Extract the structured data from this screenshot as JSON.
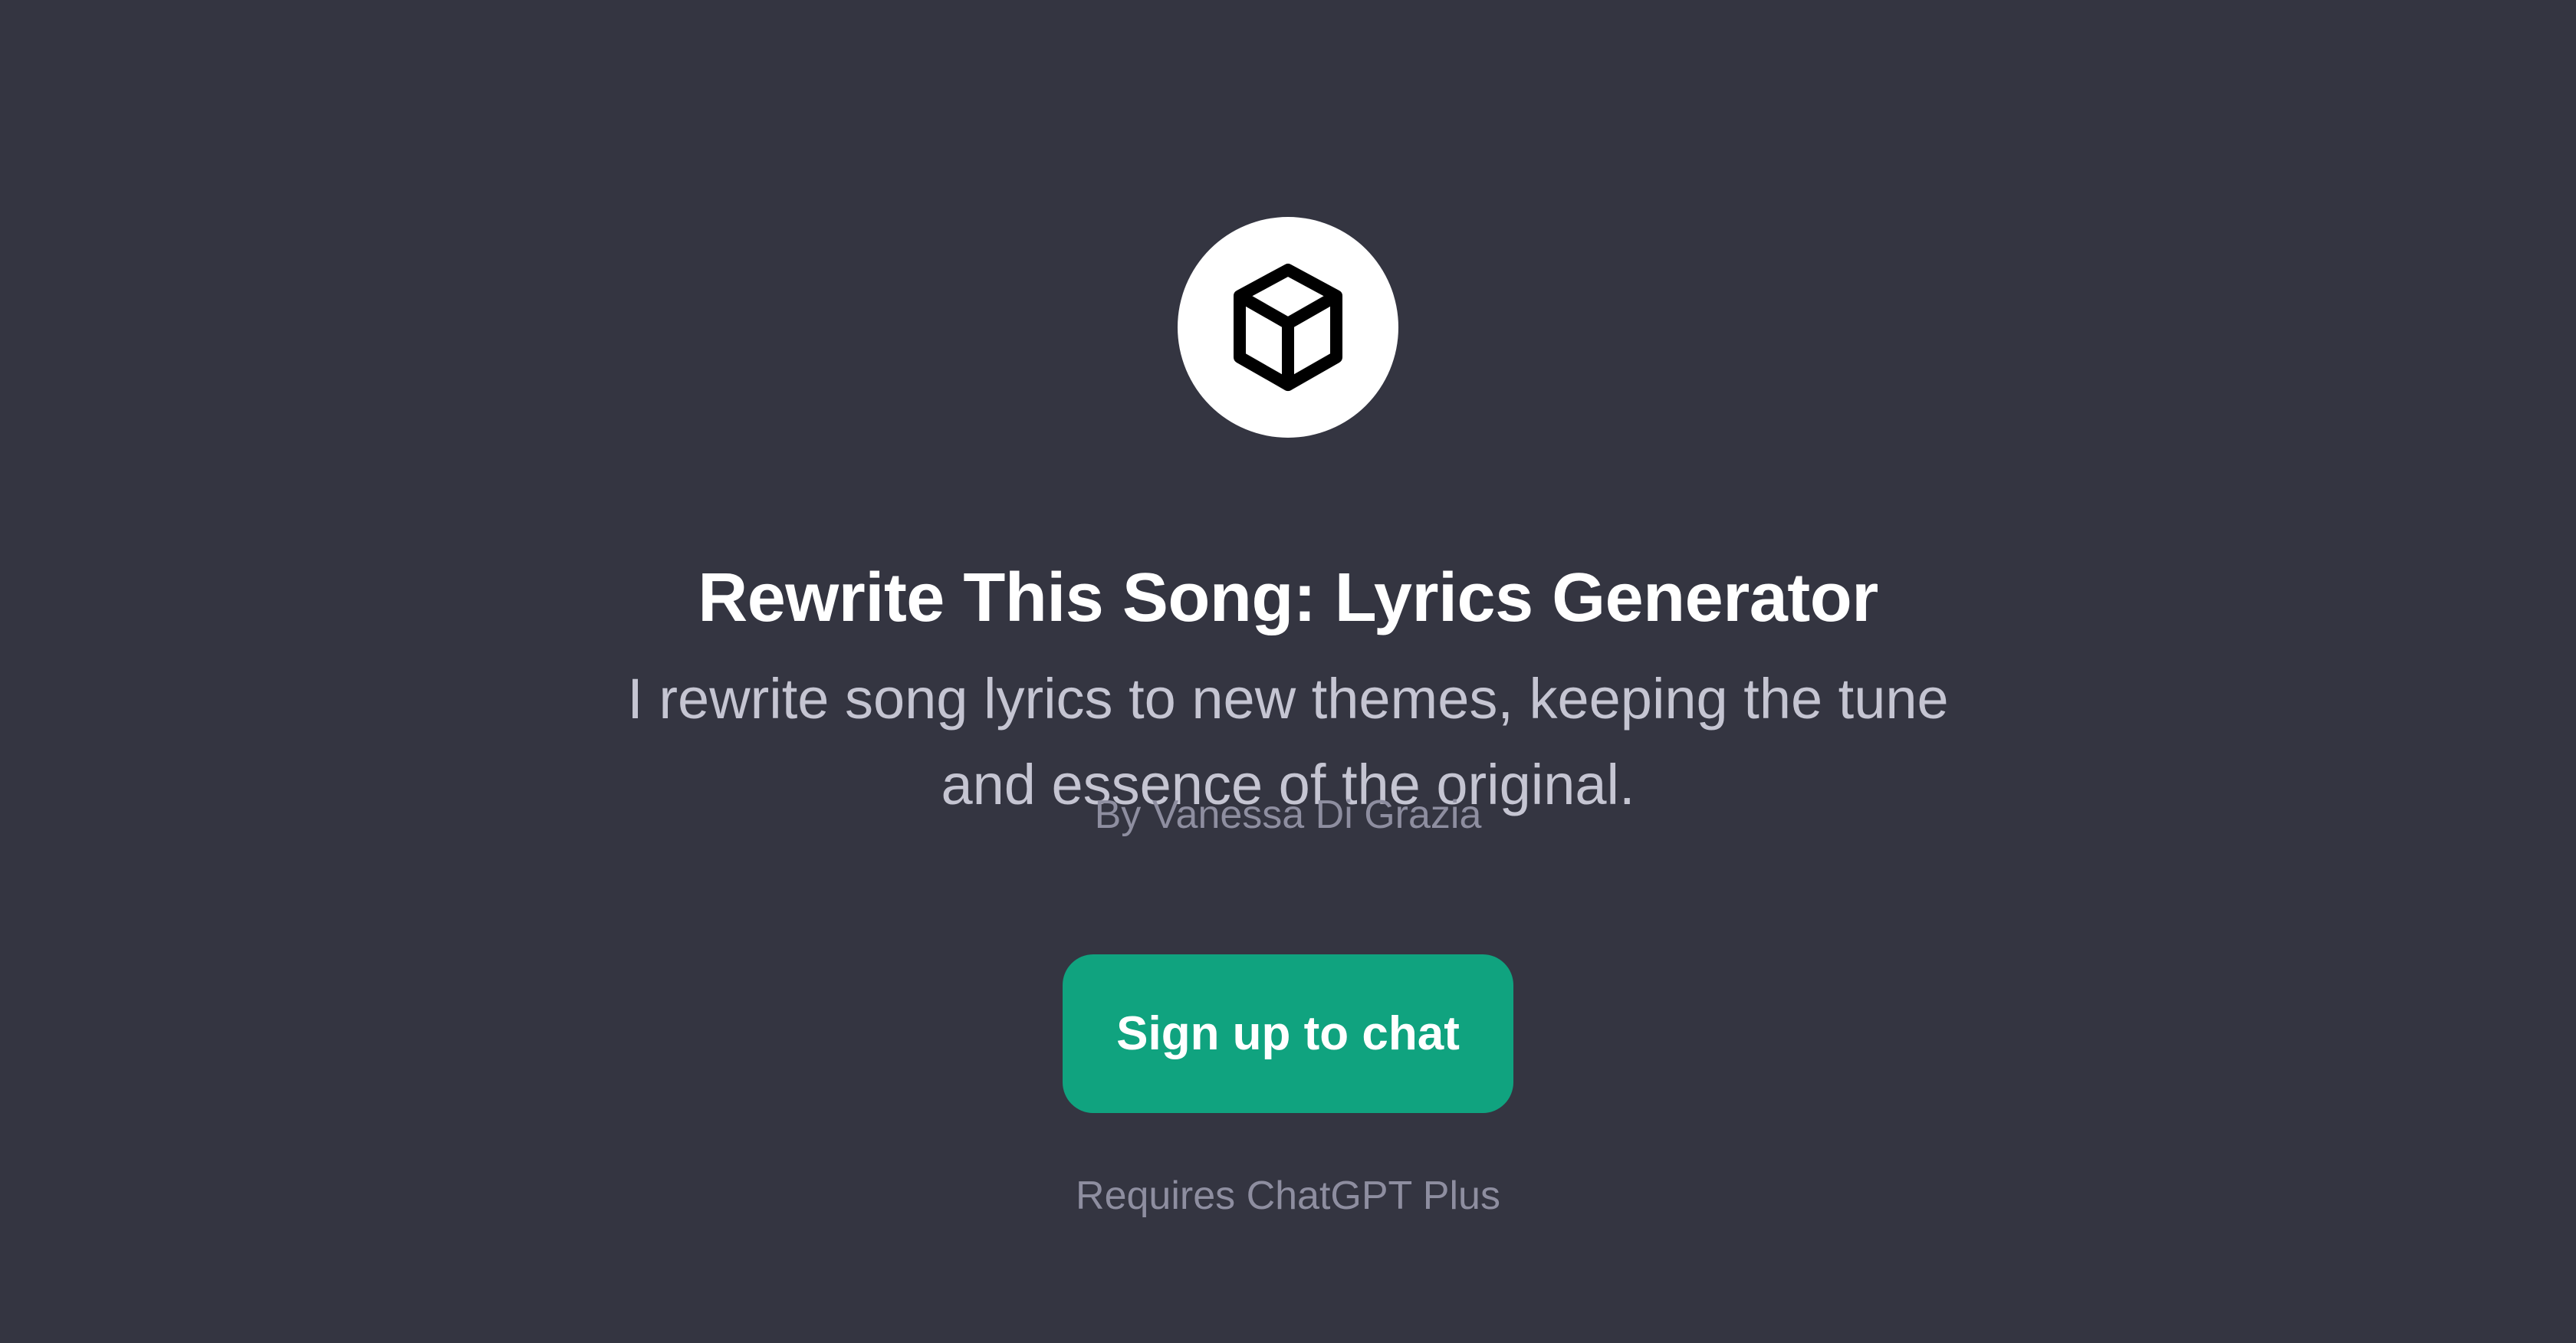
{
  "gpt": {
    "avatar_icon": "cube-icon",
    "title": "Rewrite This Song: Lyrics Generator",
    "description": "I rewrite song lyrics to new themes, keeping the tune and essence of the original.",
    "author": "By Vanessa Di Grazia"
  },
  "cta": {
    "signup_label": "Sign up to chat",
    "requirement_note": "Requires ChatGPT Plus"
  },
  "colors": {
    "background": "#343541",
    "accent": "#10a37f",
    "title_text": "#ffffff",
    "description_text": "#c5c5d2",
    "muted_text": "#8e8ea0"
  }
}
